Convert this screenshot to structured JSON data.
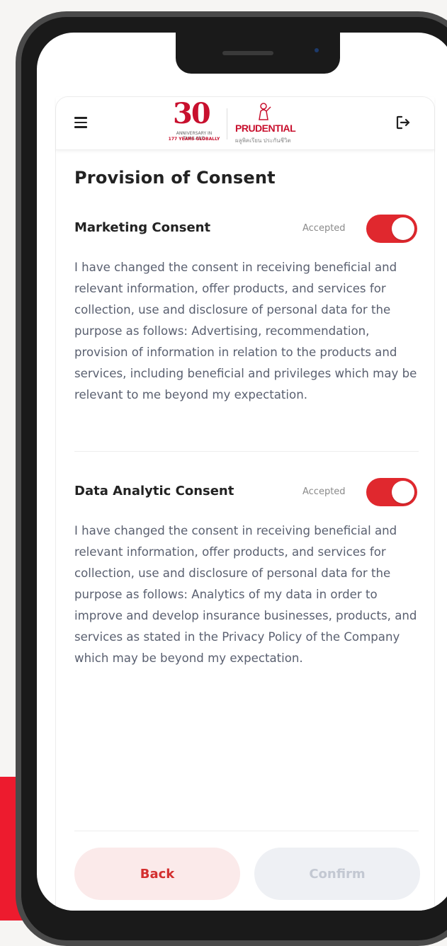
{
  "header": {
    "menu_icon": "hamburger-menu-icon",
    "logout_icon": "logout-icon",
    "anniversary_logo": {
      "number": "30",
      "line1": "ANNIVERSARY IN THAILAND",
      "line2": "177 YEARS GLOBALLY"
    },
    "brand_logo": {
      "name": "PRUDENTIAL",
      "tagline": "ผลูพิคเรียน ประกันชีวิต"
    }
  },
  "page": {
    "title": "Provision of Consent"
  },
  "consents": [
    {
      "title": "Marketing Consent",
      "status": "Accepted",
      "enabled": true,
      "description": "I have changed the consent in receiving beneficial and relevant information, offer products, and services for collection, use and disclosure of personal data for the purpose as follows: Advertising, recommendation, provision of information in relation to the products and services, including beneficial and privileges which may be relevant to me beyond my expectation."
    },
    {
      "title": "Data Analytic Consent",
      "status": "Accepted",
      "enabled": true,
      "description": "I have changed the consent in receiving beneficial and relevant information, offer products, and services for collection, use and disclosure of personal data for the purpose as follows: Analytics of my data in order to improve and develop insurance businesses, products, and services as stated in the Privacy Policy of the Company which may be beyond my expectation."
    }
  ],
  "footer": {
    "back_label": "Back",
    "confirm_label": "Confirm"
  },
  "colors": {
    "brand_red": "#ed1b2e",
    "toggle_on": "#e0282e",
    "back_button_bg": "#fbeaea",
    "confirm_button_bg": "#eef0f4"
  }
}
